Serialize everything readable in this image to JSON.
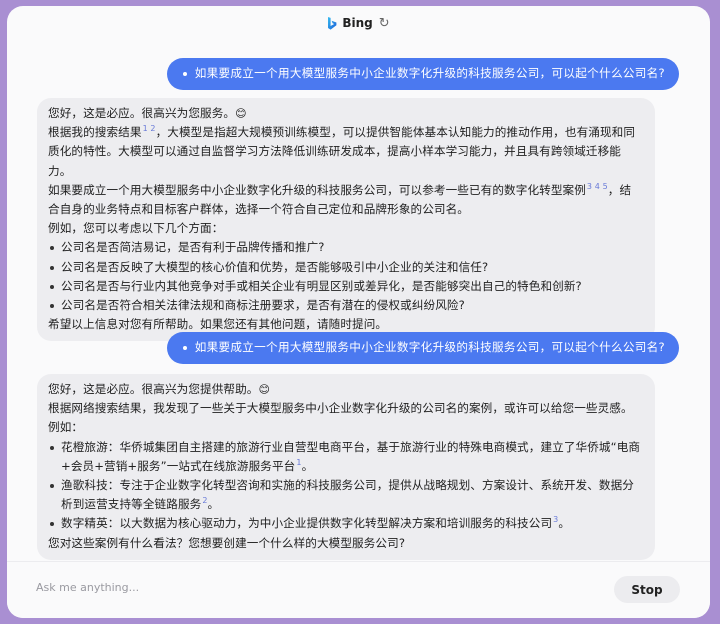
{
  "header": {
    "title": "Bing",
    "logo_icon": "bing-logo-icon",
    "refresh_icon": "refresh-icon"
  },
  "messages": [
    {
      "role": "user",
      "text": "如果要成立一个用大模型服务中小企业数字化升级的科技服务公司，可以起个什么公司名?"
    },
    {
      "role": "bot",
      "greeting": "您好，这是必应。很高兴为您服务。",
      "greeting_emoji": "😊",
      "p1": {
        "lead": "根据我的搜索结果",
        "refs": "1 2",
        "text": "，大模型是指超大规模预训练模型，可以提供智能体基本认知能力的推动作用，也有涌现和同质化的特性。大模型可以通过自监督学习方法降低训练研发成本，提高小样本学习能力，并且具有跨领域迁移能力。"
      },
      "p2": {
        "lead": "如果要成立一个用大模型服务中小企业数字化升级的科技服务公司，可以参考一些已有的数字化转型案例",
        "refs": "3 4 5",
        "text": "，结合自身的业务特点和目标客户群体，选择一个符合自己定位和品牌形象的公司名。"
      },
      "intro": "例如，您可以考虑以下几个方面：",
      "bullets": [
        "公司名是否简洁易记，是否有利于品牌传播和推广?",
        "公司名是否反映了大模型的核心价值和优势，是否能够吸引中小企业的关注和信任?",
        "公司名是否与行业内其他竞争对手或相关企业有明显区别或差异化，是否能够突出自己的特色和创新?",
        "公司名是否符合相关法律法规和商标注册要求，是否有潜在的侵权或纠纷风险?"
      ],
      "closing": "希望以上信息对您有所帮助。如果您还有其他问题，请随时提问。"
    },
    {
      "role": "user",
      "text": "如果要成立一个用大模型服务中小企业数字化升级的科技服务公司，可以起个什么公司名?"
    },
    {
      "role": "bot",
      "greeting": "您好，这是必应。很高兴为您提供帮助。",
      "greeting_emoji": "😊",
      "p1": "根据网络搜索结果，我发现了一些关于大模型服务中小企业数字化升级的公司名的案例，或许可以给您一些灵感。",
      "intro": "例如：",
      "bullets": [
        {
          "text": "花橙旅游：华侨城集团自主搭建的旅游行业自营型电商平台，基于旅游行业的特殊电商模式，建立了华侨城“电商+会员+营销+服务”一站式在线旅游服务平台",
          "ref": "1",
          "end": "。"
        },
        {
          "text": "渔歌科技：专注于企业数字化转型咨询和实施的科技服务公司，提供从战略规划、方案设计、系统开发、数据分析到运营支持等全链路服务",
          "ref": "2",
          "end": "。"
        },
        {
          "text": "数字精英：以大数据为核心驱动力，为中小企业提供数字化转型解决方案和培训服务的科技公司",
          "ref": "3",
          "end": "。"
        }
      ],
      "closing": "您对这些案例有什么看法？您想要创建一个什么样的大模型服务公司?"
    }
  ],
  "composer": {
    "placeholder": "Ask me anything...",
    "stop_label": "Stop"
  }
}
